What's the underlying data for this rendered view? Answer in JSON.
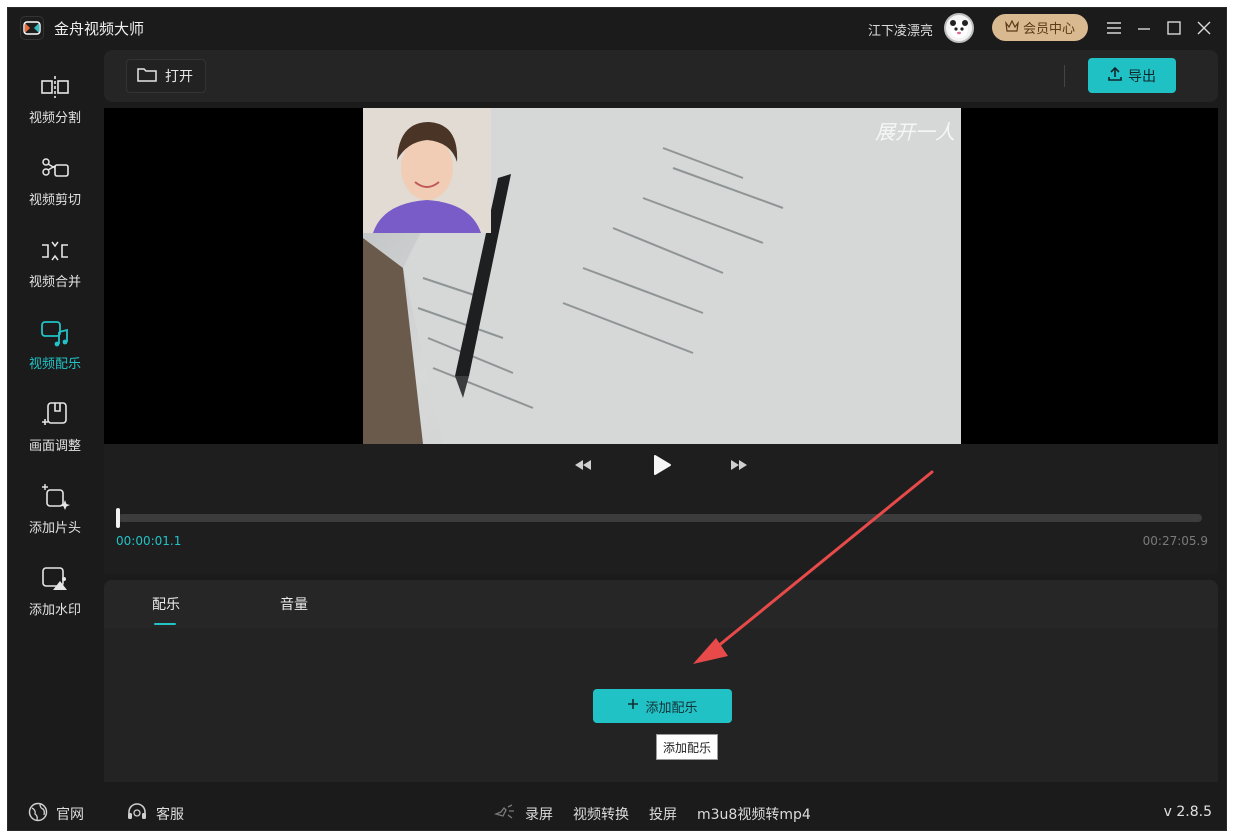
{
  "app": {
    "title": "金舟视频大师"
  },
  "header": {
    "user_name": "江下凌漂亮",
    "vip_label": "会员中心"
  },
  "sidebar": {
    "items": [
      {
        "label": "视频分割",
        "icon": "split-icon",
        "active": false
      },
      {
        "label": "视频剪切",
        "icon": "scissors-icon",
        "active": false
      },
      {
        "label": "视频合并",
        "icon": "merge-icon",
        "active": false
      },
      {
        "label": "视频配乐",
        "icon": "music-icon",
        "active": true
      },
      {
        "label": "画面调整",
        "icon": "crop-icon",
        "active": false
      },
      {
        "label": "添加片头",
        "icon": "sparkle-frame-icon",
        "active": false
      },
      {
        "label": "添加水印",
        "icon": "image-watermark-icon",
        "active": false
      }
    ]
  },
  "toolbar": {
    "open_label": "打开",
    "export_label": "导出"
  },
  "player": {
    "watermark_text": "展开一人",
    "current_time": "00:00:01.1",
    "total_time": "00:27:05.9"
  },
  "panel": {
    "tabs": [
      {
        "label": "配乐",
        "active": true
      },
      {
        "label": "音量",
        "active": false
      }
    ],
    "add_music_label": "添加配乐",
    "tooltip_text": "添加配乐"
  },
  "footer": {
    "website_label": "官网",
    "service_label": "客服",
    "links": [
      "录屏",
      "视频转换",
      "投屏",
      "m3u8视频转mp4"
    ],
    "version": "v 2.8.5"
  },
  "colors": {
    "accent": "#22c2c6",
    "background": "#1b1b1b",
    "vip": "#d9b98f",
    "annotation_arrow": "#e84a4a"
  }
}
